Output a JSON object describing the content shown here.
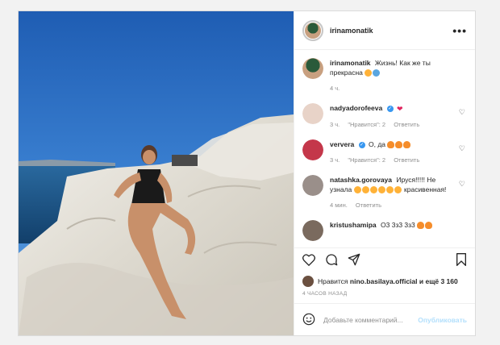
{
  "post": {
    "author": "irinamonatik",
    "more_label": "•••",
    "caption": {
      "user": "irinamonatik",
      "text": "Жизнь! Как же ты прекрасна",
      "time": "4 ч."
    },
    "comments": [
      {
        "user": "nadyadorofeeva",
        "verified": true,
        "text": "",
        "emoji": [
          "heart"
        ],
        "time": "3 ч.",
        "likes": "\"Нравится\": 2",
        "reply": "Ответить",
        "avatar_color": "#e8d3c8"
      },
      {
        "user": "ververa",
        "verified": true,
        "text": "О, да",
        "emoji": [
          "fire",
          "fire",
          "fire"
        ],
        "time": "3 ч.",
        "likes": "\"Нравится\": 2",
        "reply": "Ответить",
        "avatar_color": "#c4374a"
      },
      {
        "user": "natashka.gorovaya",
        "verified": false,
        "text": "Ируся!!!!! Не узнала",
        "text2": "красивенная!",
        "emoji": [
          "face",
          "face",
          "face",
          "face",
          "face",
          "face"
        ],
        "time": "4 мин.",
        "likes": "",
        "reply": "Ответить",
        "avatar_color": "#9a8f8a"
      },
      {
        "user": "kristushamipa",
        "verified": false,
        "text": "О3 3з3 3з3",
        "emoji": [
          "fire",
          "fire"
        ],
        "time": "",
        "likes": "",
        "reply": "",
        "avatar_color": "#7a6a5e"
      }
    ],
    "likes_prefix": "Нравится",
    "likes_user": "nino.basilaya.official",
    "likes_suffix": "и ещё 3 160",
    "time_ago": "4 ЧАСОВ НАЗАД",
    "add_comment_placeholder": "Добавьте комментарий...",
    "publish_label": "Опубликовать"
  },
  "colors": {
    "sky": "#2e6fc4",
    "sea": "#1a5a8a",
    "rock": "#e9e6df",
    "link": "#3897f0"
  },
  "icons": [
    "more-icon",
    "heart-icon",
    "comment-icon",
    "share-icon",
    "bookmark-icon",
    "smile-icon"
  ]
}
